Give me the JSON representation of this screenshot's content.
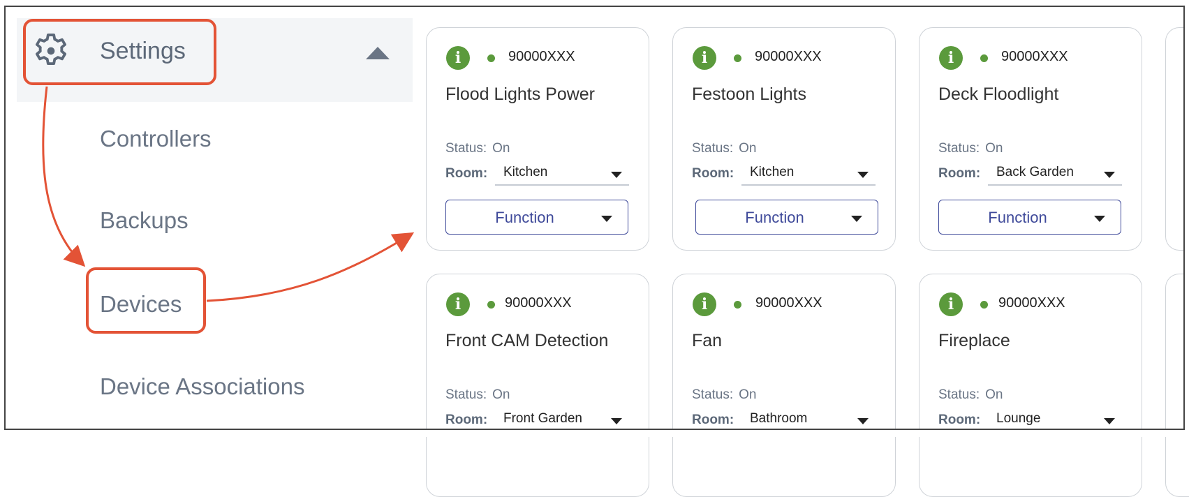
{
  "sidebar": {
    "settings_label": "Settings",
    "items": [
      {
        "label": "Controllers"
      },
      {
        "label": "Backups"
      },
      {
        "label": "Devices"
      },
      {
        "label": "Device Associations"
      }
    ]
  },
  "colors": {
    "highlight": "#e35336",
    "online": "#5b9a3c",
    "function_accent": "#3f4a9a"
  },
  "cards": [
    {
      "id": "90000XXX",
      "name": "Flood Lights Power",
      "status_label": "Status:",
      "status": "On",
      "room_label": "Room:",
      "room": "Kitchen",
      "function_label": "Function"
    },
    {
      "id": "90000XXX",
      "name": "Festoon Lights",
      "status_label": "Status:",
      "status": "On",
      "room_label": "Room:",
      "room": "Kitchen",
      "function_label": "Function"
    },
    {
      "id": "90000XXX",
      "name": "Deck Floodlight",
      "status_label": "Status:",
      "status": "On",
      "room_label": "Room:",
      "room": "Back Garden",
      "function_label": "Function"
    },
    {
      "id": "90000XXX",
      "name": "Front CAM Detection",
      "status_label": "Status:",
      "status": "On",
      "room_label": "Room:",
      "room": "Front Garden"
    },
    {
      "id": "90000XXX",
      "name": "Fan",
      "status_label": "Status:",
      "status": "On",
      "room_label": "Room:",
      "room": "Bathroom"
    },
    {
      "id": "90000XXX",
      "name": "Fireplace",
      "status_label": "Status:",
      "status": "On",
      "room_label": "Room:",
      "room": "Lounge"
    }
  ]
}
